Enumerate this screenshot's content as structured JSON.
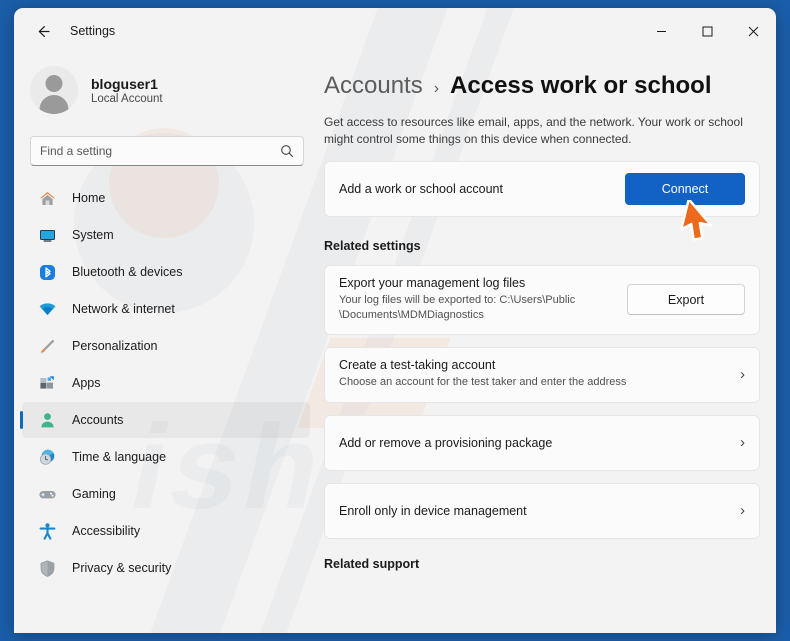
{
  "window": {
    "title": "Settings",
    "back_icon": "back-arrow-icon",
    "controls": {
      "minimize": "minimize-icon",
      "maximize": "maximize-icon",
      "close": "close-icon"
    }
  },
  "sidebar": {
    "profile": {
      "name": "bloguser1",
      "subtitle": "Local Account",
      "avatar_icon": "user-avatar-icon"
    },
    "search": {
      "placeholder": "Find a setting",
      "value": "",
      "icon": "search-icon"
    },
    "items": [
      {
        "label": "Home",
        "icon": "home-icon",
        "active": false
      },
      {
        "label": "System",
        "icon": "system-monitor-icon",
        "active": false
      },
      {
        "label": "Bluetooth & devices",
        "icon": "bluetooth-icon",
        "active": false
      },
      {
        "label": "Network & internet",
        "icon": "wifi-icon",
        "active": false
      },
      {
        "label": "Personalization",
        "icon": "paintbrush-icon",
        "active": false
      },
      {
        "label": "Apps",
        "icon": "apps-grid-icon",
        "active": false
      },
      {
        "label": "Accounts",
        "icon": "account-person-icon",
        "active": true
      },
      {
        "label": "Time & language",
        "icon": "clock-globe-icon",
        "active": false
      },
      {
        "label": "Gaming",
        "icon": "gamepad-icon",
        "active": false
      },
      {
        "label": "Accessibility",
        "icon": "accessibility-icon",
        "active": false
      },
      {
        "label": "Privacy & security",
        "icon": "shield-icon",
        "active": false
      }
    ]
  },
  "main": {
    "breadcrumb": {
      "parent": "Accounts",
      "separator": "›",
      "current": "Access work or school"
    },
    "description": "Get access to resources like email, apps, and the network. Your work or school might control some things on this device when connected.",
    "add_account_card": {
      "title": "Add a work or school account",
      "button_label": "Connect"
    },
    "related_settings_heading": "Related settings",
    "related_settings": [
      {
        "title": "Export your management log files",
        "subtitle": "Your log files will be exported to: C:\\Users\\Public \\Documents\\MDMDiagnostics",
        "button_label": "Export",
        "chevron": ""
      },
      {
        "title": "Create a test-taking account",
        "subtitle": "Choose an account for the test taker and enter the address",
        "button_label": "",
        "chevron": "›"
      },
      {
        "title": "Add or remove a provisioning package",
        "subtitle": "",
        "button_label": "",
        "chevron": "›"
      },
      {
        "title": "Enroll only in device management",
        "subtitle": "",
        "button_label": "",
        "chevron": "›"
      }
    ],
    "related_support_heading": "Related support"
  },
  "cursor": {
    "icon": "mouse-pointer-icon",
    "color": "#ED6A1C"
  },
  "colors": {
    "accent": "#1162c4",
    "desktop": "#1a5da8",
    "window_bg": "#f3f3f3",
    "card_bg": "#fbfbfb",
    "selection_indicator": "#0f6cbd"
  }
}
